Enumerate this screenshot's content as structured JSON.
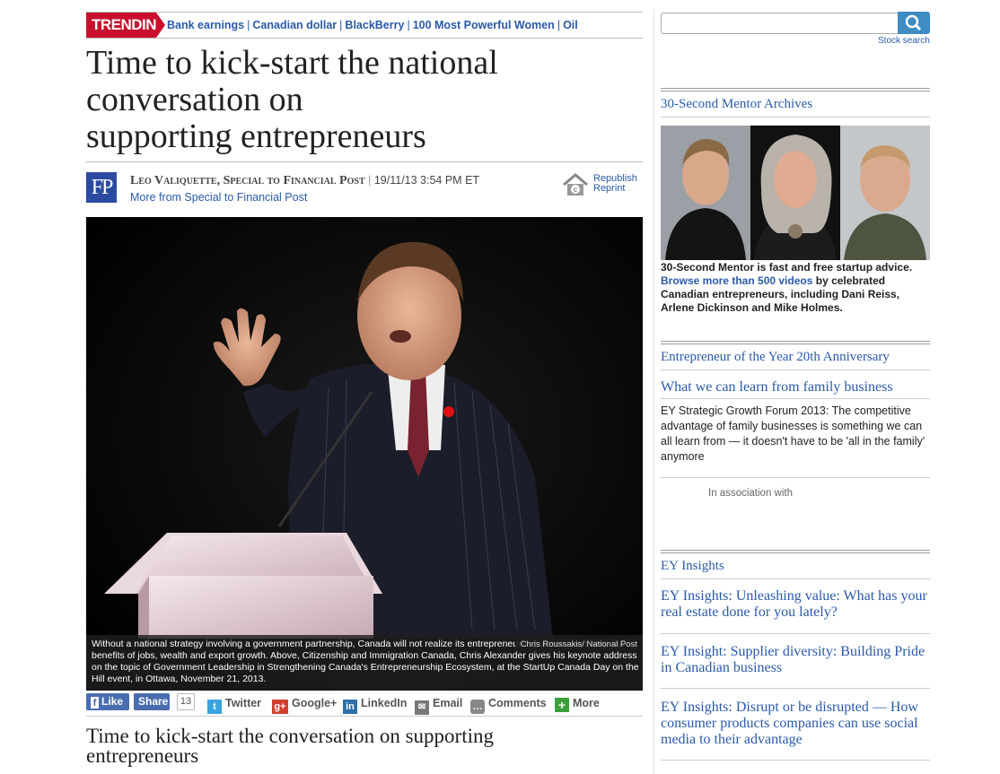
{
  "trending": {
    "badge": "TRENDING",
    "links": [
      "Bank earnings",
      "Canadian dollar",
      "BlackBerry",
      "100 Most Powerful Women",
      "Oil"
    ]
  },
  "article": {
    "headline_lines": [
      "Time to kick-start the national",
      "conversation on",
      "supporting entrepreneurs"
    ],
    "logo": "FP",
    "author": "Leo Valiquette, Special to Financial Post",
    "date": "19/11/13 3:54 PM ET",
    "more_from": "More from Special to Financial Post",
    "republish": "Republish",
    "reprint": "Reprint",
    "photo_credit": "Chris Roussakis/ National Post",
    "caption": "Without a national strategy involving a government partnership, Canada will not realize its entrepreneurial potential and reap the benefits of jobs, wealth and export growth. Above, Citizenship and Immigration Canada, Chris Alexander gives his keynote address on the topic of Government Leadership in Strengthening Canada's Entrepreneurship Ecosystem, at the StartUp Canada Day on the Hill event, in Ottawa, November 21, 2013.",
    "subhead_lines": [
      "Time to kick-start the conversation on supporting",
      "entrepreneurs"
    ]
  },
  "share": {
    "like": "Like",
    "share": "Share",
    "count": "13",
    "twitter": "Twitter",
    "googleplus": "Google+",
    "linkedin": "LinkedIn",
    "email": "Email",
    "comments": "Comments",
    "more": "More"
  },
  "sidebar": {
    "stock_search": "Stock search",
    "mentor": {
      "heading": "30-Second Mentor Archives",
      "text_a": "30-Second Mentor is fast and free startup advice.",
      "link": "Browse more than 500 videos",
      "text_b": " by celebrated Canadian entrepreneurs, including Dani Reiss, Arlene Dickinson and Mike Holmes."
    },
    "eoy": {
      "heading": "Entrepreneur of the Year 20th Anniversary",
      "link": "What we can learn from family business",
      "desc": "EY Strategic Growth Forum 2013: The competitive advantage of family businesses is something we can all learn from — it doesn't have to be 'all in the family' anymore",
      "assoc": "In association with"
    },
    "insights": {
      "heading": "EY Insights",
      "items": [
        "EY Insights: Unleashing value: What has your real estate done for you lately?",
        "EY Insight: Supplier diversity: Building Pride in Canadian business",
        "EY Insights: Disrupt or be disrupted — How consumer products companies can use social media to their advantage"
      ]
    }
  },
  "colors": {
    "accent_red": "#c8102e",
    "link_blue": "#2a5aa8",
    "facebook": "#4a6db0",
    "search_button": "#3f8cc3"
  }
}
